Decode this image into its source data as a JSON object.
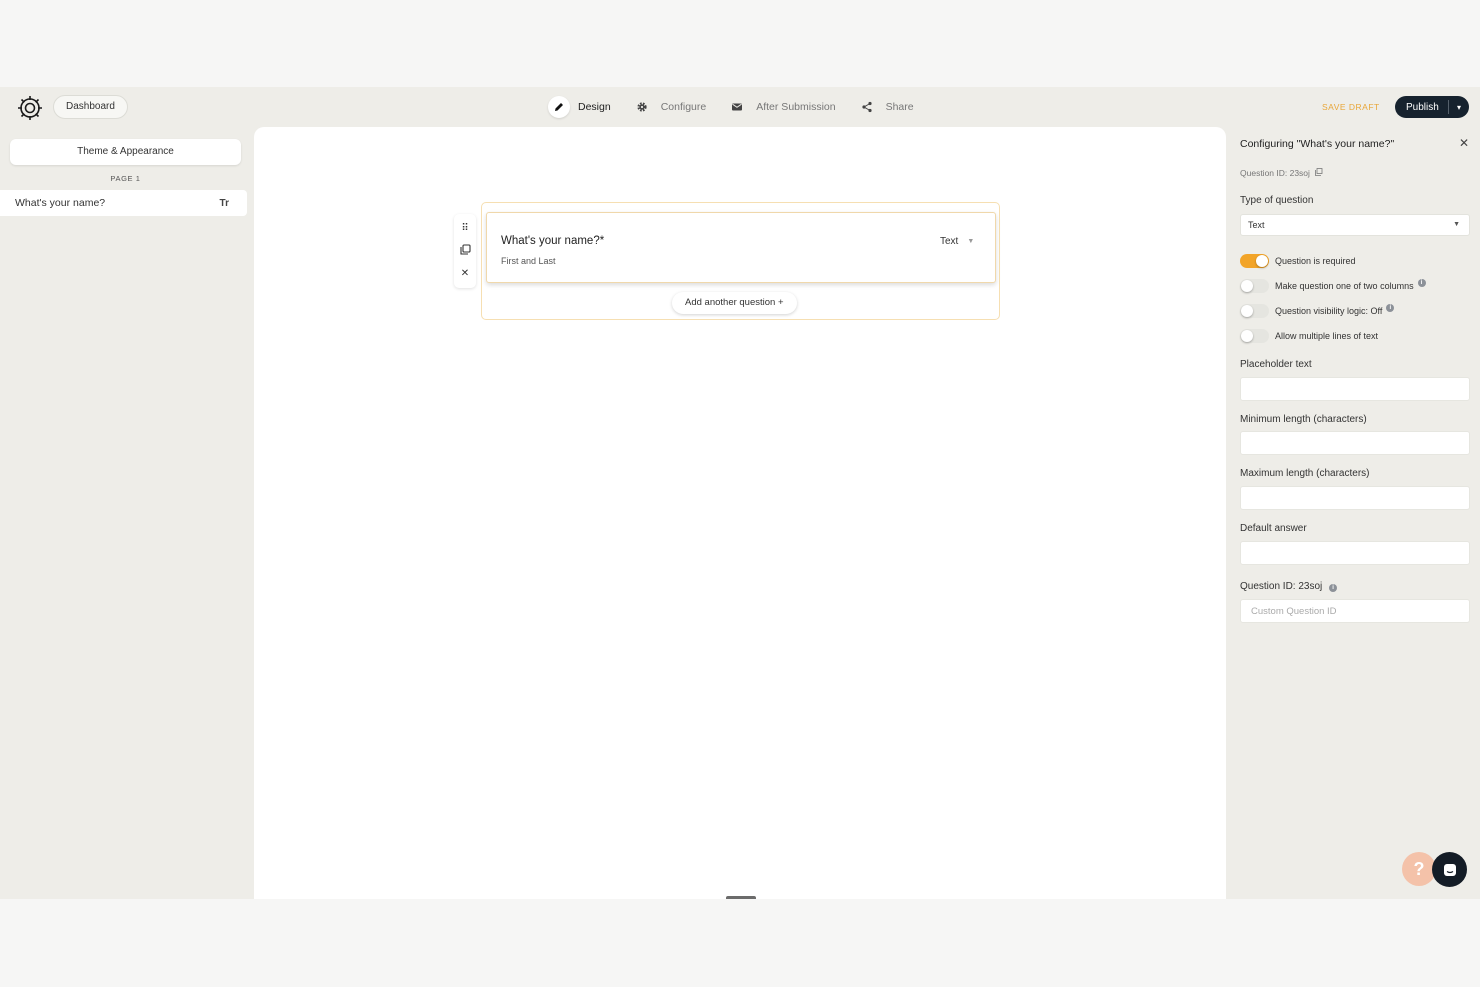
{
  "topbar": {
    "dashboard_label": "Dashboard",
    "tabs": [
      {
        "label": "Design",
        "icon": "pencil-icon",
        "active": true
      },
      {
        "label": "Configure",
        "icon": "gear-icon",
        "active": false
      },
      {
        "label": "After Submission",
        "icon": "envelope-icon",
        "active": false
      },
      {
        "label": "Share",
        "icon": "share-icon",
        "active": false
      }
    ],
    "save_draft": "SAVE DRAFT",
    "publish": "Publish"
  },
  "sidebar": {
    "theme_button": "Theme & Appearance",
    "page_label": "PAGE 1",
    "items": [
      {
        "label": "What's your name?",
        "type_icon": "Tr"
      }
    ]
  },
  "canvas": {
    "question": {
      "title": "What's your name?*",
      "subtitle": "First and Last",
      "type": "Text"
    },
    "add_question": "Add another question +"
  },
  "config": {
    "title": "Configuring \"What's your name?\"",
    "question_id_text": "Question ID: 23soj",
    "type_label": "Type of question",
    "type_value": "Text",
    "toggles": [
      {
        "label": "Question is required",
        "on": true
      },
      {
        "label": "Make question one of two columns",
        "on": false,
        "info": true
      },
      {
        "label": "Question visibility logic: Off",
        "on": false,
        "info": true
      },
      {
        "label": "Allow multiple lines of text",
        "on": false
      }
    ],
    "placeholder_label": "Placeholder text",
    "min_label": "Minimum length (characters)",
    "max_label": "Maximum length (characters)",
    "default_label": "Default answer",
    "qid_label": "Question ID: 23soj",
    "qid_placeholder": "Custom Question ID"
  },
  "colors": {
    "accent": "#f2a428",
    "dark": "#16222e",
    "save_draft": "#e8a73a"
  }
}
